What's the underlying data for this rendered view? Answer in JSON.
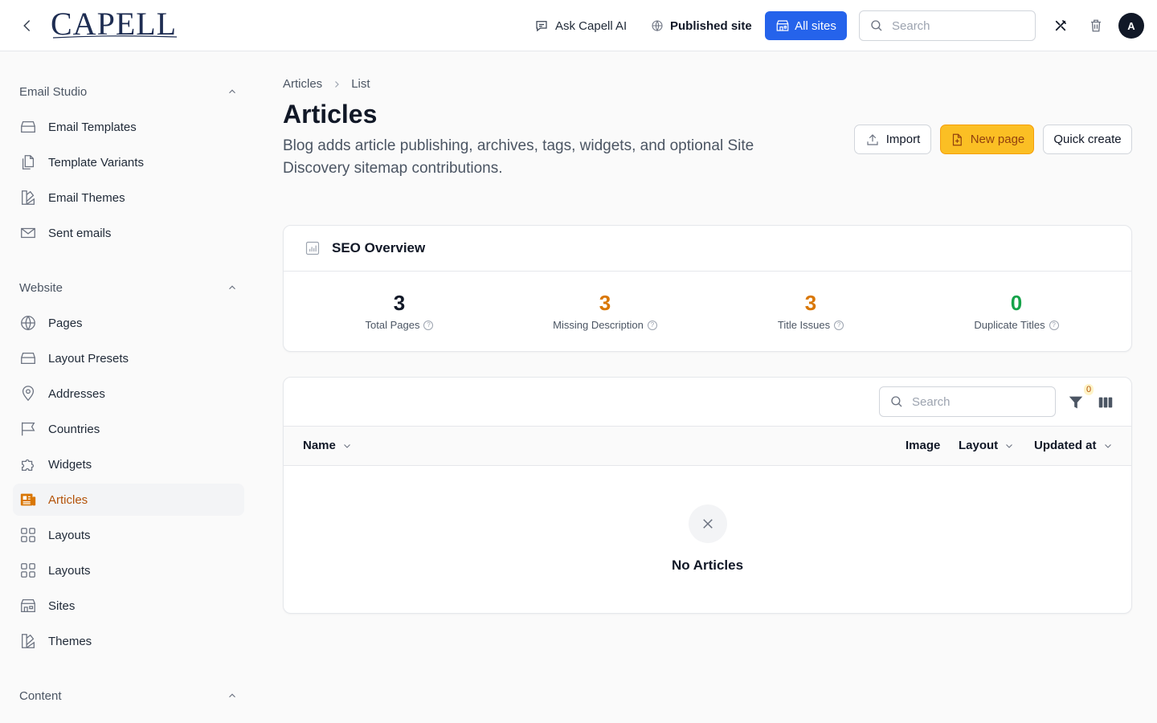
{
  "header": {
    "logo": "CAPELL",
    "ask_ai": "Ask Capell AI",
    "published_site": "Published site",
    "all_sites": "All sites",
    "search_placeholder": "Search",
    "avatar_initial": "A"
  },
  "sidebar": {
    "sections": [
      {
        "title": "Email Studio",
        "items": [
          {
            "label": "Email Templates",
            "icon": "tray-icon"
          },
          {
            "label": "Template Variants",
            "icon": "documents-icon"
          },
          {
            "label": "Email Themes",
            "icon": "swatch-icon"
          },
          {
            "label": "Sent emails",
            "icon": "envelope-icon"
          }
        ]
      },
      {
        "title": "Website",
        "items": [
          {
            "label": "Pages",
            "icon": "globe-icon"
          },
          {
            "label": "Layout Presets",
            "icon": "tray-icon"
          },
          {
            "label": "Addresses",
            "icon": "map-pin-icon"
          },
          {
            "label": "Countries",
            "icon": "flag-icon"
          },
          {
            "label": "Widgets",
            "icon": "puzzle-icon"
          },
          {
            "label": "Articles",
            "icon": "newspaper-icon",
            "active": true
          },
          {
            "label": "Layouts",
            "icon": "squares-icon"
          },
          {
            "label": "Layouts",
            "icon": "squares-icon"
          },
          {
            "label": "Sites",
            "icon": "building-icon"
          },
          {
            "label": "Themes",
            "icon": "swatch-icon"
          }
        ]
      },
      {
        "title": "Content",
        "items": []
      }
    ]
  },
  "breadcrumb": {
    "parent": "Articles",
    "current": "List"
  },
  "page": {
    "title": "Articles",
    "description": "Blog adds article publishing, archives, tags, widgets, and optional Site Discovery sitemap contributions."
  },
  "actions": {
    "import": "Import",
    "new_page": "New page",
    "quick_create": "Quick create"
  },
  "seo": {
    "title": "SEO Overview",
    "stats": [
      {
        "value": "3",
        "label": "Total Pages",
        "color": "#111827"
      },
      {
        "value": "3",
        "label": "Missing Description",
        "color": "#d97706"
      },
      {
        "value": "3",
        "label": "Title Issues",
        "color": "#d97706"
      },
      {
        "value": "0",
        "label": "Duplicate Titles",
        "color": "#16a34a"
      }
    ]
  },
  "table": {
    "search_placeholder": "Search",
    "filter_count": "0",
    "columns": {
      "name": "Name",
      "image": "Image",
      "layout": "Layout",
      "updated_at": "Updated at"
    },
    "empty_text": "No Articles"
  },
  "colors": {
    "accent": "#2563eb",
    "brand": "#1e2d52",
    "primary_action": "#fbbf24",
    "active_nav": "#b45309"
  }
}
